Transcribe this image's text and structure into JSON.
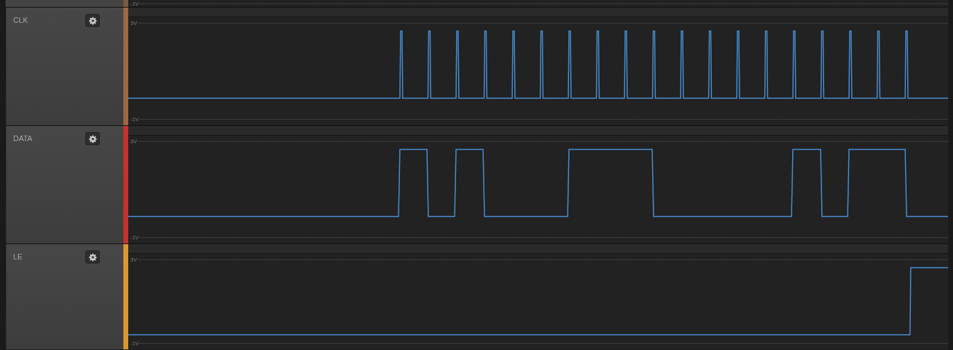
{
  "top_strip": {
    "y_min": "-1V"
  },
  "channels": [
    {
      "name": "CLK",
      "color": "#a0683e",
      "y_max": "3V",
      "y_min": "-1V"
    },
    {
      "name": "DATA",
      "color": "#c8302c",
      "y_max": "3V",
      "y_min": "-1V"
    },
    {
      "name": "LE",
      "color": "#e0962a",
      "y_max": "3V",
      "y_min": "-1V"
    }
  ]
}
